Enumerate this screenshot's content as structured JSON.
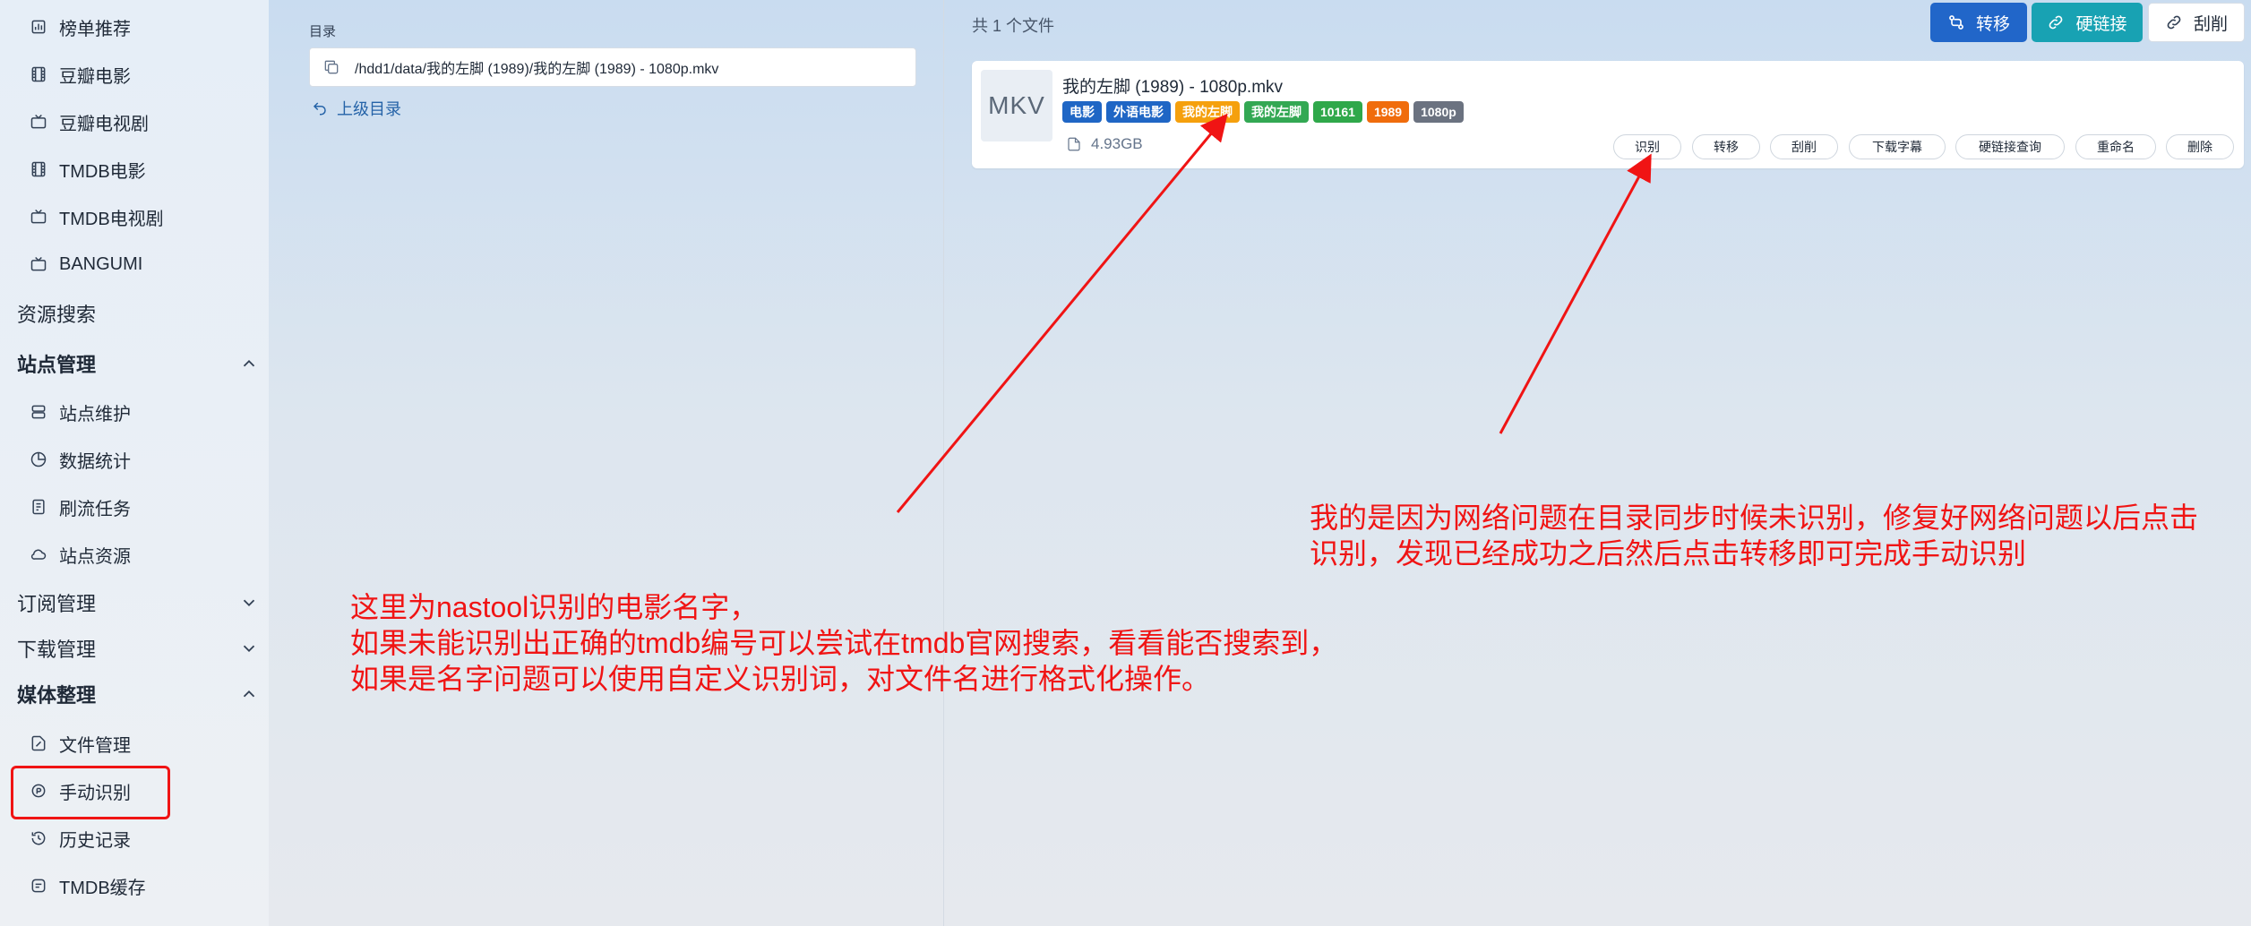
{
  "sidebar": {
    "items": [
      {
        "label": "榜单推荐",
        "icon": "chart-icon"
      },
      {
        "label": "豆瓣电影",
        "icon": "film-icon"
      },
      {
        "label": "豆瓣电视剧",
        "icon": "tv-icon"
      },
      {
        "label": "TMDB电影",
        "icon": "film-icon"
      },
      {
        "label": "TMDB电视剧",
        "icon": "tv-icon"
      },
      {
        "label": "BANGUMI",
        "icon": "tv-icon"
      }
    ],
    "resource_search": "资源搜索",
    "site_section": {
      "title": "站点管理",
      "items": [
        {
          "label": "站点维护",
          "icon": "server-icon"
        },
        {
          "label": "数据统计",
          "icon": "pie-chart-icon"
        },
        {
          "label": "刷流任务",
          "icon": "checklist-icon"
        },
        {
          "label": "站点资源",
          "icon": "cloud-icon"
        }
      ]
    },
    "subscribe_section": {
      "title": "订阅管理"
    },
    "download_section": {
      "title": "下载管理"
    },
    "media_section": {
      "title": "媒体整理",
      "items": [
        {
          "label": "文件管理",
          "icon": "file-edit-icon"
        },
        {
          "label": "手动识别",
          "icon": "recognize-icon"
        },
        {
          "label": "历史记录",
          "icon": "history-icon"
        },
        {
          "label": "TMDB缓存",
          "icon": "cache-icon"
        }
      ]
    }
  },
  "directory": {
    "label": "目录",
    "path": "/hdd1/data/我的左脚 (1989)/我的左脚 (1989) - 1080p.mkv",
    "up_link": "上级目录"
  },
  "files": {
    "count_text": "共 1 个文件",
    "toolbar": {
      "transfer": "转移",
      "hardlink": "硬链接",
      "scrape": "刮削"
    },
    "item": {
      "thumb": "MKV",
      "name": "我的左脚 (1989) - 1080p.mkv",
      "tags": [
        {
          "text": "电影",
          "color": "#1f66c5"
        },
        {
          "text": "外语电影",
          "color": "#1f66c5"
        },
        {
          "text": "我的左脚",
          "color": "#f5a00d"
        },
        {
          "text": "我的左脚",
          "color": "#33a853"
        },
        {
          "text": "10161",
          "color": "#2fa84a"
        },
        {
          "text": "1989",
          "color": "#f06c0c"
        },
        {
          "text": "1080p",
          "color": "#6b7280"
        }
      ],
      "size": "4.93GB",
      "actions": [
        "识别",
        "转移",
        "刮削",
        "下载字幕",
        "硬链接查询",
        "重命名",
        "删除"
      ]
    }
  },
  "annotations": {
    "left": [
      "这里为nastool识别的电影名字，",
      "如果未能识别出正确的tmdb编号可以尝试在tmdb官网搜索，看看能否搜索到，",
      "如果是名字问题可以使用自定义识别词，对文件名进行格式化操作。"
    ],
    "right": [
      "我的是因为网络问题在目录同步时候未识别，修复好网络问题以后点击",
      "识别，发现已经成功之后然后点击转移即可完成手动识别"
    ],
    "color": "#f01414"
  }
}
